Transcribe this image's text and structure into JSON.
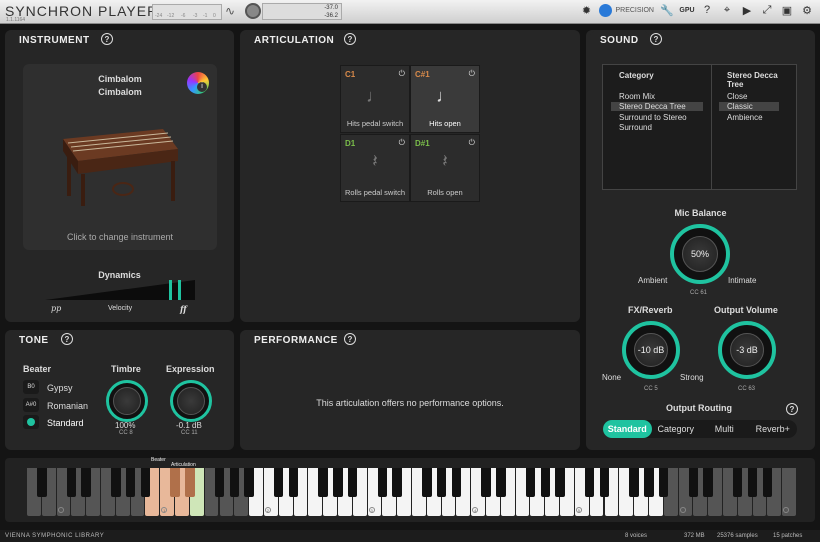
{
  "app": {
    "title": "SYNCHRON PLAYER",
    "version": "1.1.1164",
    "meter_ticks": [
      "-24",
      "-12",
      "-6",
      "-3",
      "-1",
      "0"
    ],
    "levels": [
      "-37.0",
      "-36.2"
    ],
    "precision": "PRECISION",
    "gpu": "GPU"
  },
  "instrument": {
    "tab": "INSTRUMENT",
    "name1": "Cimbalom",
    "name2": "Cimbalom",
    "change_hint": "Click to change instrument",
    "dynamics": "Dynamics",
    "pp": "pp",
    "velocity": "Velocity",
    "ff": "ff"
  },
  "tone": {
    "tab": "TONE",
    "beater_label": "Beater",
    "beaters": [
      {
        "key": "B0",
        "label": "Gypsy"
      },
      {
        "key": "A#0",
        "label": "Romanian"
      },
      {
        "key": "",
        "label": "Standard"
      }
    ],
    "timbre": "Timbre",
    "timbre_val": "100%",
    "timbre_cc": "CC 8",
    "expression": "Expression",
    "expression_val": "-0.1 dB",
    "expression_cc": "CC 11"
  },
  "articulation": {
    "tab": "ARTICULATION",
    "cells": [
      {
        "key": "C1",
        "label": "Hits pedal switch"
      },
      {
        "key": "C#1",
        "label": "Hits open"
      },
      {
        "key": "D1",
        "label": "Rolls pedal switch"
      },
      {
        "key": "D#1",
        "label": "Rolls open"
      }
    ]
  },
  "performance": {
    "tab": "PERFORMANCE",
    "message": "This articulation offers no performance options."
  },
  "sound": {
    "tab": "SOUND",
    "col1_header": "Category",
    "col2_header": "Stereo Decca Tree",
    "categories": [
      "Room Mix",
      "Stereo Decca Tree",
      "Surround to Stereo",
      "Surround"
    ],
    "mics": [
      "Close",
      "Classic",
      "Ambience"
    ],
    "mic_balance": "Mic Balance",
    "mic_val": "50%",
    "ambient": "Ambient",
    "intimate": "Intimate",
    "mic_cc": "CC 61",
    "fx": "FX/Reverb",
    "fx_val": "-10 dB",
    "none": "None",
    "strong": "Strong",
    "fx_cc": "CC 5",
    "out_vol": "Output Volume",
    "out_val": "-3 dB",
    "out_cc": "CC 63",
    "routing_label": "Output Routing",
    "routing": [
      "Standard",
      "Category",
      "Multi",
      "Reverb+"
    ]
  },
  "keyboard": {
    "beater": "Beater",
    "articulation": "Articulation",
    "octaves": [
      "0",
      "1",
      "2",
      "3",
      "4",
      "5",
      "6",
      "7",
      "8"
    ]
  },
  "status": {
    "brand": "VIENNA SYMPHONIC LIBRARY",
    "voices": "8 voices",
    "memory": "372 MB",
    "samples": "25376 samples",
    "patches": "15 patches"
  },
  "colors": {
    "accent": "#1fc3a0",
    "orange": "#d88a4a",
    "green": "#7bbf4a"
  }
}
